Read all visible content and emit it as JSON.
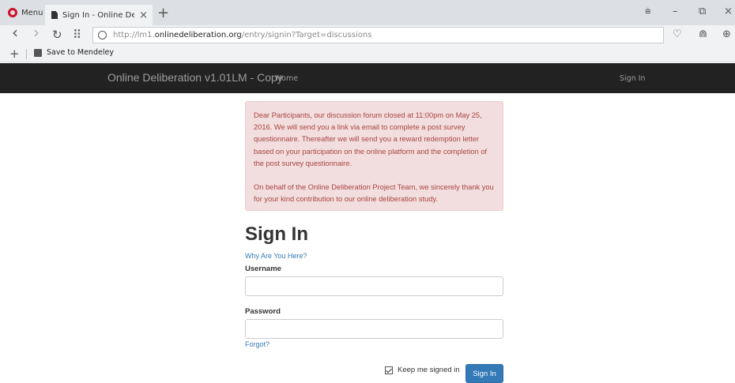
{
  "browser": {
    "menu_label": "Menu",
    "tab_title": "Sign In - Online Deliberatio",
    "tab_close": "×",
    "new_tab": "+",
    "url_prefix": "http://lm1.",
    "url_domain": "onlinedeliberation.org",
    "url_path": "/entry/signin?Target=discussions",
    "bookmark_label": "Save to Mendeley",
    "bookmark_add": "+",
    "controls": {
      "menu": "⩧",
      "minimize": "–",
      "restore": "⧉",
      "close": "×"
    },
    "nav": {
      "back": "‹",
      "forward": "›",
      "reload": "↻",
      "speed_dial": "⠿"
    },
    "right_icons": {
      "heart": "♡",
      "news": "⋒",
      "download": "⊕"
    },
    "accent_color": "#d0112b"
  },
  "site": {
    "brand": "Online Deliberation v1.01LM - Copy",
    "nav_home": "Home",
    "nav_signin": "Sign In"
  },
  "alert": {
    "paragraph1": "Dear Participants, our discussion forum closed at 11:00pm on May 25, 2016. We will send you a link via email to complete a post survey questionnaire. Thereafter we will send you a reward redemption letter based on your participation on the online platform and the completion of the post survey questionnaire.",
    "paragraph2": "On behalf of the Online Deliberation Project Team, we sincerely thank you for your kind contribution to our online deliberation study."
  },
  "form": {
    "title": "Sign In",
    "why_link": "Why Are You Here?",
    "username_label": "Username",
    "username_value": "",
    "password_label": "Password",
    "password_value": "",
    "forgot_link": "Forgot?",
    "keep_signed_in": "Keep me signed in",
    "keep_checked": true,
    "submit_label": "Sign In"
  }
}
